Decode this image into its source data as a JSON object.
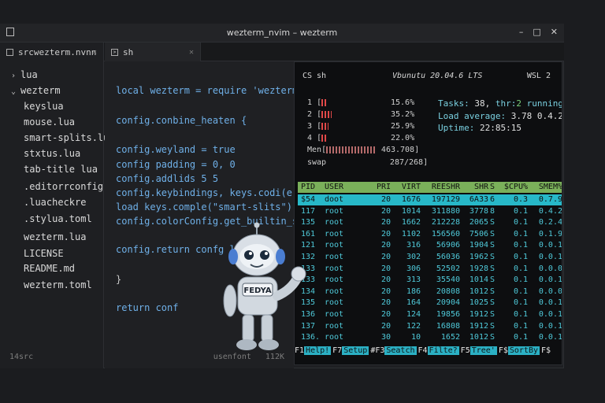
{
  "window": {
    "title": "wezterm_nvim – wezterm"
  },
  "tabs": [
    {
      "label": "srcwezterm.nvnn"
    },
    {
      "label": "sh"
    }
  ],
  "sidebar": {
    "items": [
      {
        "label": "lua",
        "type": "folder",
        "expanded": false
      },
      {
        "label": "wezterm",
        "type": "folder",
        "expanded": true
      },
      {
        "label": "keyslua"
      },
      {
        "label": "mouse.lua"
      },
      {
        "label": "smart-splits.lua"
      },
      {
        "label": "stxtus.lua"
      },
      {
        "label": "tab-title lua"
      },
      {
        "label": ".editorrconfig"
      },
      {
        "label": ".luacheckre"
      },
      {
        "label": ".stylua.toml"
      },
      {
        "label": "wezterm.lua"
      },
      {
        "label": "LICENSE"
      },
      {
        "label": "README.md"
      },
      {
        "label": "wezterm.toml"
      }
    ],
    "footer": "14src"
  },
  "editor": {
    "lines": [
      "local wezterm = require 'wezterm'",
      "config.conbine_heaten {",
      "config.weyland = true",
      "config padding = 0, 0",
      "config.addlids 5  5",
      "config.keybindings, keys.codi(e)",
      "load keys.comple(\"smart-slits\")",
      "config.colorConfig.get_builtin_se e",
      "config.return confg lon",
      "}",
      "return conf"
    ],
    "status_font": "usenfont",
    "status_size": "112K"
  },
  "terminal": {
    "cs": "CS",
    "shell": "sh",
    "os": "Vbunutu 20.04.6 LTS",
    "wsl": "WSL 2",
    "cpus": [
      {
        "id": "1",
        "value": "15.6%",
        "percent": 15.6
      },
      {
        "id": "2",
        "value": "35.2%",
        "percent": 35.2
      },
      {
        "id": "3",
        "value": "25.9%",
        "percent": 25.9
      },
      {
        "id": "4",
        "value": "22.0%",
        "percent": 22.0
      }
    ],
    "mem": {
      "label": "Men",
      "value": "463.708]",
      "percent": 95
    },
    "swap": {
      "label": "swap",
      "value": "287/268]"
    },
    "tasks": {
      "label": "Tasks:",
      "count": "38,",
      "thr_label": "thr:",
      "thr": "2",
      "running": "running"
    },
    "load": {
      "label": "Load average:",
      "values": "3.78 0.4.2"
    },
    "uptime": {
      "label": "Uptime:",
      "value": "22:85:15"
    },
    "columns": [
      "PID",
      "USER",
      "PRI",
      "VIRT",
      "REESHR",
      "SHR",
      "S",
      "$CPU%",
      "SMEM%"
    ],
    "processes": [
      {
        "pid": "$54",
        "user": "doot",
        "pri": "20",
        "virt": "1676",
        "res": "197129",
        "shr": "6A33",
        "s": "6",
        "cpu": "0.3",
        "mem": "0.7.9",
        "selected": true
      },
      {
        "pid": "117",
        "user": "root",
        "pri": "20",
        "virt": "1014",
        "res": "311880",
        "shr": "3778",
        "s": "8",
        "cpu": "0.1",
        "mem": "0.4.2"
      },
      {
        "pid": "135",
        "user": "root",
        "pri": "20",
        "virt": "1662",
        "res": "212228",
        "shr": "2065",
        "s": "S",
        "cpu": "0.1",
        "mem": "0.2.4"
      },
      {
        "pid": "161",
        "user": "root",
        "pri": "20",
        "virt": "1102",
        "res": "156560",
        "shr": "7506",
        "s": "S",
        "cpu": "0.1",
        "mem": "0.1.9"
      },
      {
        "pid": "121",
        "user": "root",
        "pri": "20",
        "virt": "316",
        "res": "56906",
        "shr": "1904",
        "s": "S",
        "cpu": "0.1",
        "mem": "0.0.1"
      },
      {
        "pid": "132",
        "user": "root",
        "pri": "20",
        "virt": "302",
        "res": "56036",
        "shr": "1962",
        "s": "S",
        "cpu": "0.1",
        "mem": "0.0.1"
      },
      {
        "pid": "133",
        "user": "root",
        "pri": "20",
        "virt": "306",
        "res": "52502",
        "shr": "1928",
        "s": "S",
        "cpu": "0.1",
        "mem": "0.0.0"
      },
      {
        "pid": "133",
        "user": "root",
        "pri": "20",
        "virt": "313",
        "res": "35540",
        "shr": "1014",
        "s": "S",
        "cpu": "0.1",
        "mem": "0.0.1"
      },
      {
        "pid": "134",
        "user": "root",
        "pri": "20",
        "virt": "186",
        "res": "20808",
        "shr": "1012",
        "s": "S",
        "cpu": "0.1",
        "mem": "0.0.0"
      },
      {
        "pid": "135",
        "user": "root",
        "pri": "20",
        "virt": "164",
        "res": "20904",
        "shr": "1025",
        "s": "S",
        "cpu": "0.1",
        "mem": "0.0.1"
      },
      {
        "pid": "136",
        "user": "root",
        "pri": "20",
        "virt": "124",
        "res": "19856",
        "shr": "1912",
        "s": "S",
        "cpu": "0.1",
        "mem": "0.0.1"
      },
      {
        "pid": "137",
        "user": "root",
        "pri": "20",
        "virt": "122",
        "res": "16808",
        "shr": "1912",
        "s": "S",
        "cpu": "0.1",
        "mem": "0.0.1"
      },
      {
        "pid": "136.",
        "user": "root",
        "pri": "30",
        "virt": "10",
        "res": "1652",
        "shr": "1012",
        "s": "S",
        "cpu": "0.1",
        "mem": "0.0.1"
      }
    ],
    "fkeys": [
      {
        "key": "F1",
        "label": "Help!"
      },
      {
        "key": "F7",
        "label": "Setup"
      },
      {
        "key": "#F3",
        "label": "Seatch"
      },
      {
        "key": "F4",
        "label": "Filte?"
      },
      {
        "key": "F5",
        "label": "Tree'"
      },
      {
        "key": "F$",
        "label": "SortBy"
      },
      {
        "key": "F$",
        "label": ""
      }
    ]
  },
  "mascot": {
    "badge": "FEDYA"
  },
  "colors": {
    "keyword": "#6fb0e8",
    "string": "#e6d07a",
    "header_green": "#7ab05a",
    "selected_cyan": "#27b8c8",
    "process_text": "#4fc9d9"
  }
}
